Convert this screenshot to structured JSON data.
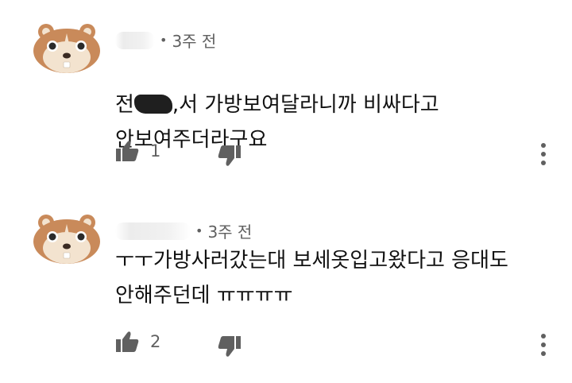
{
  "comments": [
    {
      "time": "3주 전",
      "text_prefix": "전",
      "text_rest": ",서 가방보여달라니까 비싸다고\n안보여주더라구요",
      "likes": "1",
      "avatar": "hamster-avatar-icon"
    },
    {
      "time": "3주 전",
      "text": "ㅜㅜ가방사러갔는대 보세옷입고왔다고 응대도\n안해주던데 ㅠㅠㅠㅠ",
      "likes": "2",
      "avatar": "hamster-avatar-icon"
    }
  ],
  "icons": {
    "like": "thumbs-up-icon",
    "dislike": "thumbs-down-icon",
    "menu": "more-vertical-icon"
  },
  "colors": {
    "text": "#0f0f0f",
    "secondary": "#606060",
    "avatar_fur": "#c98a5a",
    "avatar_face": "#f3e3cf"
  }
}
